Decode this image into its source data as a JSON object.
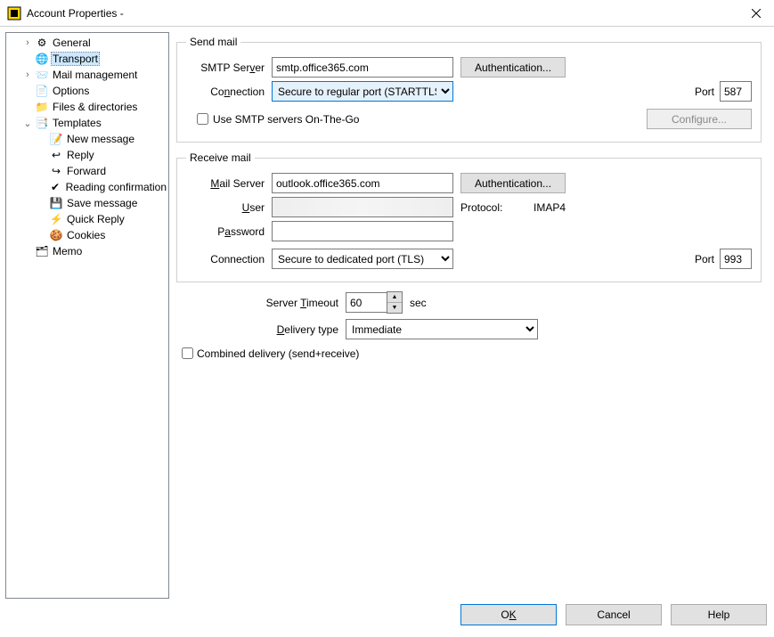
{
  "window": {
    "title": "Account Properties - "
  },
  "tree": {
    "items": [
      {
        "id": "general",
        "label": "General",
        "level": 1,
        "expand": ">",
        "icon": "⚙"
      },
      {
        "id": "transport",
        "label": "Transport",
        "level": 1,
        "expand": "",
        "icon": "🌐",
        "selected": true
      },
      {
        "id": "mail-management",
        "label": "Mail management",
        "level": 1,
        "expand": ">",
        "icon": "📨"
      },
      {
        "id": "options",
        "label": "Options",
        "level": 1,
        "expand": "",
        "icon": "📄"
      },
      {
        "id": "files-directories",
        "label": "Files & directories",
        "level": 1,
        "expand": "",
        "icon": "📁"
      },
      {
        "id": "templates",
        "label": "Templates",
        "level": 1,
        "expand": "v",
        "icon": "📑"
      },
      {
        "id": "new-message",
        "label": "New message",
        "level": 2,
        "expand": "",
        "icon": "📝"
      },
      {
        "id": "reply",
        "label": "Reply",
        "level": 2,
        "expand": "",
        "icon": "↩"
      },
      {
        "id": "forward",
        "label": "Forward",
        "level": 2,
        "expand": "",
        "icon": "↪"
      },
      {
        "id": "reading-confirmation",
        "label": "Reading confirmation",
        "level": 2,
        "expand": "",
        "icon": "✔"
      },
      {
        "id": "save-message",
        "label": "Save message",
        "level": 2,
        "expand": "",
        "icon": "💾"
      },
      {
        "id": "quick-reply",
        "label": "Quick Reply",
        "level": 2,
        "expand": "",
        "icon": "⚡"
      },
      {
        "id": "cookies",
        "label": "Cookies",
        "level": 2,
        "expand": "",
        "icon": "🍪"
      },
      {
        "id": "memo",
        "label": "Memo",
        "level": 1,
        "expand": "",
        "icon": "🗂"
      }
    ]
  },
  "send": {
    "legend": "Send mail",
    "smtp_label_pre": "SMTP Ser",
    "smtp_label_hot": "v",
    "smtp_label_post": "er",
    "smtp_value": "smtp.office365.com",
    "auth_btn": "Authentication...",
    "conn_label_pre": "Co",
    "conn_label_hot": "n",
    "conn_label_post": "nection",
    "conn_value": "Secure to regular port (STARTTLS)",
    "port_label_pre": "P",
    "port_label_hot": "o",
    "port_label_post": "rt",
    "port_value": "587",
    "otg_label": "Use SMTP servers On-The-Go",
    "configure_btn": "Configure..."
  },
  "receive": {
    "legend": "Receive mail",
    "mail_label_hot": "M",
    "mail_label_post": "ail Server",
    "mail_value": "outlook.office365.com",
    "auth_btn": "Authentication...",
    "user_label_hot": "U",
    "user_label_post": "ser",
    "protocol_label": "Protocol:",
    "protocol_value": "IMAP4",
    "pass_label_pre": "P",
    "pass_label_hot": "a",
    "pass_label_post": "ssword",
    "conn_label": "Connection",
    "conn_value": "Secure to dedicated port (TLS)",
    "port_label": "Port",
    "port_value": "993"
  },
  "timeout": {
    "label_pre": "Server ",
    "label_hot": "T",
    "label_post": "imeout",
    "value": "60",
    "unit": "sec"
  },
  "delivery": {
    "label_hot": "D",
    "label_post": "elivery type",
    "value": "Immediate"
  },
  "combined": {
    "label_hot": "C",
    "label_post": "ombined delivery (send+receive)"
  },
  "footer": {
    "ok_pre": "O",
    "ok_hot": "K",
    "cancel": "Cancel",
    "help": "Help"
  }
}
